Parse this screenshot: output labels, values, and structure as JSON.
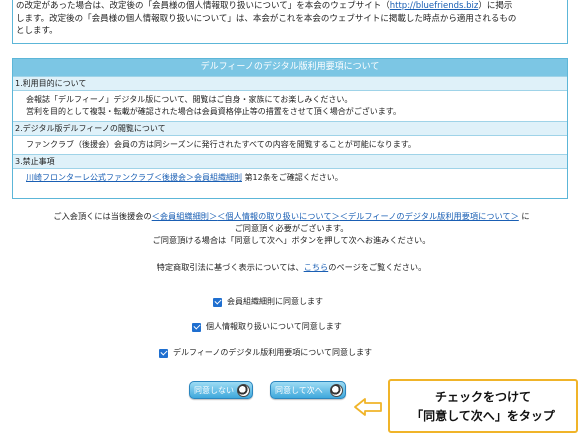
{
  "top_notice": {
    "line1_a": "の改定があった場合は、改定後の「会員様の個人情報取り扱いについて」を本会のウェブサイト（",
    "line1_link": "http://bluefriends.biz",
    "line1_b": "）に掲示",
    "line2": "します。改定後の「会員様の個人情報取り扱いについて」は、本会がこれを本会のウェブサイトに掲載した時点から適用されるもの",
    "line3": "とします。"
  },
  "terms": {
    "title": "デルフィーノのデジタル版利用要項について",
    "sections": [
      {
        "head": "1.利用目的について",
        "body1": "会報誌「デルフィーノ」デジタル版について、閲覧はご自身・家族にてお楽しみください。",
        "body2": "営利を目的として複製・転載が確認された場合は会員資格停止等の措置をさせて頂く場合がございます。"
      },
      {
        "head": "2.デジタル版デルフィーノの閲覧について",
        "body1": "ファンクラブ（後援会）会員の方は同シーズンに発行されたすべての内容を閲覧することが可能になります。"
      },
      {
        "head": "3.禁止事項",
        "link": "川崎フロンターレ公式ファンクラブ＜後援会＞会員組織細則",
        "after": " 第12条をご確認ください。"
      }
    ]
  },
  "agreement": {
    "line1_prefix": "ご入会頂くには当後援会の",
    "link1": "＜会員組織細則＞",
    "link2": "＜個人情報の取り扱いについて＞",
    "link3": "＜デルフィーノのデジタル版利用要項について＞",
    "line1_suffix": " に",
    "line2": "ご同意頂く必要がございます。",
    "line3": "ご同意頂ける場合は「同意して次へ」ボタンを押して次へお進みください。",
    "law_prefix": "特定商取引法に基づく表示については、",
    "law_link": "こちら",
    "law_suffix": "のページをご覧ください。"
  },
  "checkboxes": [
    {
      "label": "会員組織細則に同意します",
      "checked": true
    },
    {
      "label": "個人情報取り扱いについて同意します",
      "checked": true
    },
    {
      "label": "デルフィーノのデジタル版利用要項について同意します",
      "checked": true
    }
  ],
  "buttons": {
    "disagree": "同意しない",
    "agree": "同意して次へ"
  },
  "callout": {
    "line1": "チェックをつけて",
    "line2": "「同意して次へ」をタップ"
  },
  "colors": {
    "accent": "#7cc6e4",
    "link": "#1a5fb4",
    "checkbox": "#1f6fd0",
    "callout_border": "#f0b429"
  }
}
